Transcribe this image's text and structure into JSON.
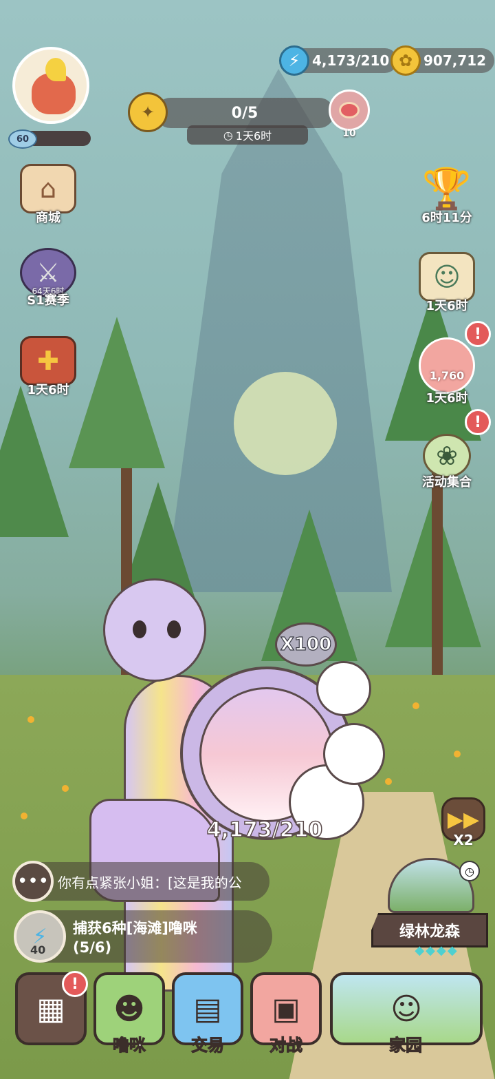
{
  "hud": {
    "energy": "4,173/210",
    "coins": "907,712",
    "level": "60",
    "level_progress": 0.15
  },
  "quest": {
    "progress": "0/5",
    "timer": "1天6时",
    "reward_count": "10"
  },
  "left_menu": [
    {
      "label": "商城",
      "sub": ""
    },
    {
      "label": "S1赛季",
      "sub": "64天6时"
    },
    {
      "label": "1天6时",
      "sub": ""
    }
  ],
  "right_menu": [
    {
      "label": "6时11分"
    },
    {
      "label": "1天6时"
    },
    {
      "label": "1天6时",
      "count": "1,760"
    },
    {
      "label": "活动集合"
    }
  ],
  "alerts": {
    "symbol": "!"
  },
  "cannon": {
    "multiplier": "X100",
    "tank": "4,173/210"
  },
  "speed": {
    "label": "X2"
  },
  "chat": {
    "text": "你有点紧张小姐：[这是我的公"
  },
  "mission": {
    "icon_value": "40",
    "title": "捕获6种[海滩]噜咪",
    "progress": "(5/6)"
  },
  "area": {
    "name": "绿林龙森",
    "stars": "◆◆◆◆"
  },
  "nav": [
    {
      "label": ""
    },
    {
      "label": "噜咪"
    },
    {
      "label": "交易"
    },
    {
      "label": "对战"
    },
    {
      "label": "家园"
    }
  ]
}
